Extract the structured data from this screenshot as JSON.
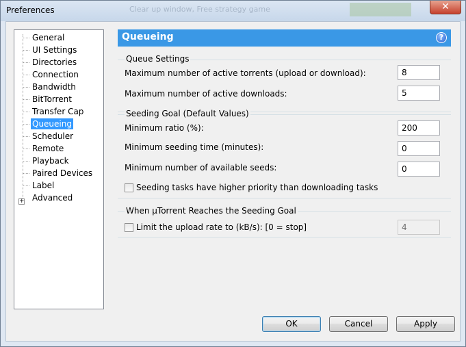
{
  "window": {
    "title": "Preferences",
    "close_glyph": "✕",
    "background_hint": "Clear up window, Free strategy game"
  },
  "sidebar": {
    "items": [
      {
        "label": "General"
      },
      {
        "label": "UI Settings"
      },
      {
        "label": "Directories"
      },
      {
        "label": "Connection"
      },
      {
        "label": "Bandwidth"
      },
      {
        "label": "BitTorrent"
      },
      {
        "label": "Transfer Cap"
      },
      {
        "label": "Queueing",
        "selected": true
      },
      {
        "label": "Scheduler"
      },
      {
        "label": "Remote"
      },
      {
        "label": "Playback"
      },
      {
        "label": "Paired Devices"
      },
      {
        "label": "Label"
      },
      {
        "label": "Advanced",
        "expandable": true
      }
    ],
    "expander_glyph": "+"
  },
  "panel": {
    "title": "Queueing",
    "help_glyph": "?",
    "accent_color": "#3a98e6"
  },
  "queue_settings": {
    "title": "Queue Settings",
    "max_active_torrents_label": "Maximum number of active torrents (upload or download):",
    "max_active_torrents_value": "8",
    "max_active_downloads_label": "Maximum number of active downloads:",
    "max_active_downloads_value": "5"
  },
  "seeding_goal": {
    "title": "Seeding Goal (Default Values)",
    "min_ratio_label": "Minimum ratio (%):",
    "min_ratio_value": "200",
    "min_seeding_time_label": "Minimum seeding time (minutes):",
    "min_seeding_time_value": "0",
    "min_seeds_label": "Minimum number of available seeds:",
    "min_seeds_value": "0",
    "priority_checkbox_label": "Seeding tasks have higher priority than downloading tasks",
    "priority_checked": false
  },
  "reaches_goal": {
    "title": "When µTorrent Reaches the Seeding Goal",
    "limit_upload_label": "Limit the upload rate to (kB/s): [0 = stop]",
    "limit_upload_checked": false,
    "limit_upload_value": "4"
  },
  "buttons": {
    "ok": "OK",
    "cancel": "Cancel",
    "apply": "Apply"
  }
}
